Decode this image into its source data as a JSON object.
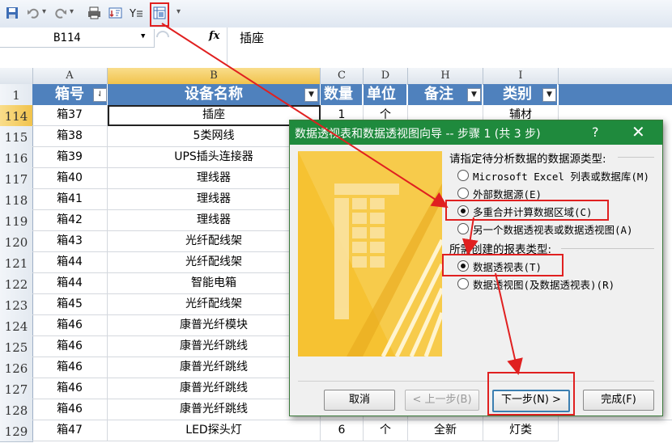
{
  "toolbar": {
    "icons": [
      "save-icon",
      "undo-icon",
      "redo-icon",
      "print-preview-icon",
      "sort-icon",
      "filter-icon",
      "pivot-wizard-icon",
      "customize-dropdown-icon"
    ]
  },
  "formula_bar": {
    "name_box": "B114",
    "fx_label": "fx",
    "value": "插座"
  },
  "grid": {
    "columns": [
      {
        "letter": "A",
        "header": "箱号"
      },
      {
        "letter": "B",
        "header": "设备名称"
      },
      {
        "letter": "C",
        "header": "数量"
      },
      {
        "letter": "D",
        "header": "单位"
      },
      {
        "letter": "H",
        "header": "备注"
      },
      {
        "letter": "I",
        "header": "类别"
      }
    ],
    "header_row_number": "1",
    "rows": [
      {
        "num": "114",
        "cells": [
          "箱37",
          "插座",
          "1",
          "个",
          "",
          "辅材"
        ]
      },
      {
        "num": "115",
        "cells": [
          "箱38",
          "5类网线",
          "",
          "",
          "",
          ""
        ]
      },
      {
        "num": "116",
        "cells": [
          "箱39",
          "UPS插头连接器",
          "",
          "",
          "",
          ""
        ]
      },
      {
        "num": "117",
        "cells": [
          "箱40",
          "理线器",
          "",
          "",
          "",
          ""
        ]
      },
      {
        "num": "118",
        "cells": [
          "箱41",
          "理线器",
          "",
          "",
          "",
          ""
        ]
      },
      {
        "num": "119",
        "cells": [
          "箱42",
          "理线器",
          "",
          "",
          "",
          ""
        ]
      },
      {
        "num": "120",
        "cells": [
          "箱43",
          "光纤配线架",
          "",
          "",
          "",
          ""
        ]
      },
      {
        "num": "121",
        "cells": [
          "箱44",
          "光纤配线架",
          "",
          "",
          "",
          ""
        ]
      },
      {
        "num": "122",
        "cells": [
          "箱44",
          "智能电箱",
          "",
          "",
          "",
          ""
        ]
      },
      {
        "num": "123",
        "cells": [
          "箱45",
          "光纤配线架",
          "",
          "",
          "",
          ""
        ]
      },
      {
        "num": "124",
        "cells": [
          "箱46",
          "康普光纤模块",
          "",
          "",
          "",
          ""
        ]
      },
      {
        "num": "125",
        "cells": [
          "箱46",
          "康普光纤跳线",
          "",
          "",
          "",
          ""
        ]
      },
      {
        "num": "126",
        "cells": [
          "箱46",
          "康普光纤跳线",
          "",
          "",
          "",
          ""
        ]
      },
      {
        "num": "127",
        "cells": [
          "箱46",
          "康普光纤跳线",
          "",
          "",
          "",
          ""
        ]
      },
      {
        "num": "128",
        "cells": [
          "箱46",
          "康普光纤跳线",
          "5",
          "条",
          "",
          "线类"
        ]
      },
      {
        "num": "129",
        "cells": [
          "箱47",
          "LED探头灯",
          "6",
          "个",
          "全新",
          "灯类"
        ]
      }
    ],
    "extra_col_text": "室业亲：八年"
  },
  "dialog": {
    "title": "数据透视表和数据透视图向导 -- 步骤 1 (共 3 步)",
    "help": "?",
    "close": "✕",
    "source_label": "请指定待分析数据的数据源类型:",
    "source_options": [
      {
        "label": "Microsoft Excel 列表或数据库(M)",
        "checked": false
      },
      {
        "label": "外部数据源(E)",
        "checked": false
      },
      {
        "label": "多重合并计算数据区域(C)",
        "checked": true
      },
      {
        "label": "另一个数据透视表或数据透视图(A)",
        "checked": false
      }
    ],
    "report_label": "所需创建的报表类型:",
    "report_options": [
      {
        "label": "数据透视表(T)",
        "checked": true
      },
      {
        "label": "数据透视图(及数据透视表)(R)",
        "checked": false
      }
    ],
    "buttons": {
      "cancel": "取消",
      "back": "< 上一步(B)",
      "next": "下一步(N) >",
      "finish": "完成(F)"
    }
  },
  "colors": {
    "header_blue": "#4f81bd",
    "title_green": "#1f8a3d",
    "annotation_red": "#e02020",
    "art_yellow": "#f6c232"
  }
}
